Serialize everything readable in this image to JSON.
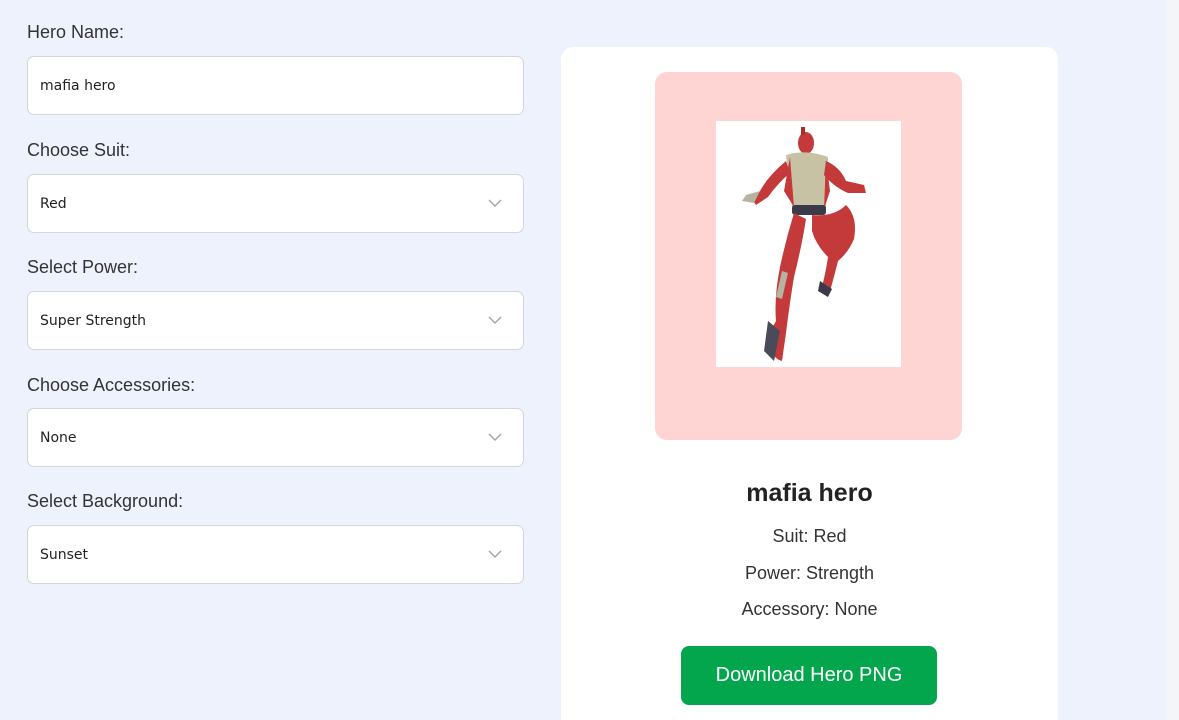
{
  "form": {
    "hero_name": {
      "label": "Hero Name:",
      "value": "mafia hero"
    },
    "suit": {
      "label": "Choose Suit:",
      "value": "Red"
    },
    "power": {
      "label": "Select Power:",
      "value": "Super Strength"
    },
    "accessories": {
      "label": "Choose Accessories:",
      "value": "None"
    },
    "background": {
      "label": "Select Background:",
      "value": "Sunset"
    }
  },
  "card": {
    "hero_name": "mafia hero",
    "suit_line": "Suit: Red",
    "power_line": "Power: Strength",
    "accessory_line": "Accessory: None",
    "download_label": "Download Hero PNG",
    "preview_bg_color": "#ffd5d4",
    "button_color": "#04a64d"
  },
  "icons": {
    "dropdown": "chevron-down-icon",
    "hero_figure": "superhero-figure"
  }
}
